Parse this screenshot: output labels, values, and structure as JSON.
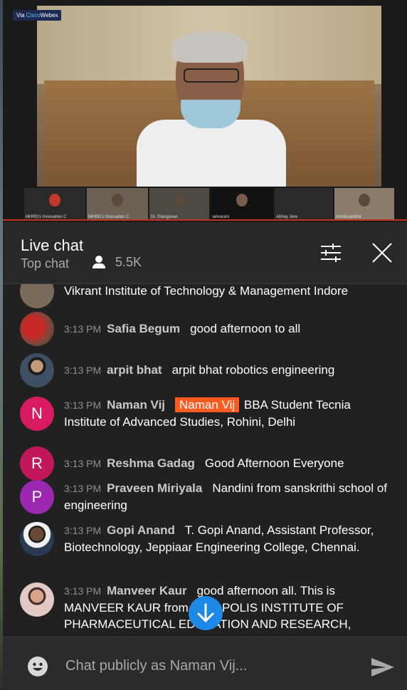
{
  "video": {
    "badge_prefix": "Via ",
    "badge_accent": "Cisco",
    "badge_suffix": "Webex",
    "thumbnails": [
      "MHRD's Innovation C",
      "MHRD's Innovation C",
      "Dr. Elangovan",
      "selvarani",
      "Abhay Jere",
      "mohitsambhir"
    ]
  },
  "header": {
    "title": "Live chat",
    "subtitle": "Top chat",
    "viewers": "5.5K",
    "filter_icon": "tune-icon",
    "close_icon": "close-icon"
  },
  "messages": [
    {
      "time": "",
      "author": "",
      "mention": "",
      "text": "Vikrant Institute of Technology & Management Indore",
      "avatar_letter": "",
      "avatar_color": "#7a6a5a"
    },
    {
      "time": "3:13 PM",
      "author": "Safia Begum",
      "mention": "",
      "text": "good afternoon to all",
      "avatar_letter": "",
      "avatar_color": "#6b2b2b"
    },
    {
      "time": "3:13 PM",
      "author": "arpit bhat",
      "mention": "",
      "text": "arpit bhat robotics engineering",
      "avatar_letter": "",
      "avatar_color": "#2f3d4a"
    },
    {
      "time": "3:13 PM",
      "author": "Naman Vij",
      "mention": "Naman Vij",
      "text": " BBA Student Tecnia Institute of Advanced Studies, Rohini, Delhi",
      "avatar_letter": "N",
      "avatar_color": "#d81b60"
    },
    {
      "time": "3:13 PM",
      "author": "Reshma Gadag",
      "mention": "",
      "text": "Good Afternoon Everyone",
      "avatar_letter": "R",
      "avatar_color": "#c2185b"
    },
    {
      "time": "3:13 PM",
      "author": "Praveen Miriyala",
      "mention": "",
      "text": "Nandini from sanskrithi school of engineering",
      "avatar_letter": "P",
      "avatar_color": "#9c27b0"
    },
    {
      "time": "3:13 PM",
      "author": "Gopi Anand",
      "mention": "",
      "text": "T. Gopi Anand, Assistant Professor, Biotechnology, Jeppiaar Engineering College, Chennai.",
      "avatar_letter": "",
      "avatar_color": "#4a4035"
    },
    {
      "time": "3:13 PM",
      "author": "Manveer Kaur",
      "mention": "",
      "text": "good afternoon all. This is MANVEER KAUR from INDOPOLIS INSTITUTE OF PHARMACEUTICAL EDUCATION AND RESEARCH,",
      "avatar_letter": "",
      "avatar_color": "#c28a8a"
    }
  ],
  "composer": {
    "placeholder": "Chat publicly as Naman Vij...",
    "emoji_icon": "emoji-icon",
    "send_icon": "send-icon"
  },
  "colors": {
    "mention_bg": "#ff5a1f",
    "scroll_button": "#1e88e5"
  }
}
